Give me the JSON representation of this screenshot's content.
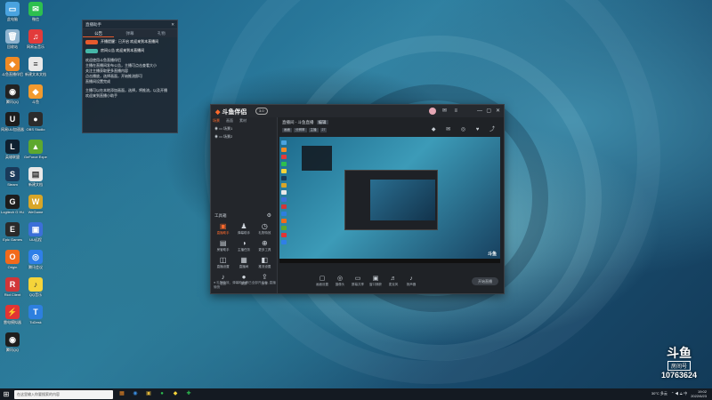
{
  "desktop": {
    "icons": [
      {
        "label": "此电脑",
        "glyph": "▭",
        "color": "#4aa3df"
      },
      {
        "label": "微信",
        "glyph": "✉",
        "color": "#2dbf4f"
      },
      {
        "label": "回收站",
        "glyph": "🗑",
        "color": "#8fb4cf"
      },
      {
        "label": "网易云音乐",
        "glyph": "♫",
        "color": "#e23b3b"
      },
      {
        "label": "斗鱼直播伴侣",
        "glyph": "◆",
        "color": "#f08a24"
      },
      {
        "label": "新建文本文档",
        "glyph": "≡",
        "color": "#e8e8e8"
      },
      {
        "label": "腾讯QQ",
        "glyph": "◉",
        "color": "#222"
      },
      {
        "label": "斗鱼",
        "glyph": "◆",
        "color": "#f29a2e"
      },
      {
        "label": "网易UU加速器",
        "glyph": "U",
        "color": "#1d1d1d"
      },
      {
        "label": "OBS Studio",
        "glyph": "●",
        "color": "#2c2c2c"
      },
      {
        "label": "英雄联盟",
        "glyph": "L",
        "color": "#0f2030"
      },
      {
        "label": "GeForce Experience",
        "glyph": "▲",
        "color": "#5da82e"
      },
      {
        "label": "Steam",
        "glyph": "S",
        "color": "#1a3a5a"
      },
      {
        "label": "新建文档",
        "glyph": "▤",
        "color": "#e8e8e8"
      },
      {
        "label": "Logitech G HUB",
        "glyph": "G",
        "color": "#1c1c1c"
      },
      {
        "label": "WeGame",
        "glyph": "W",
        "color": "#d8a628"
      },
      {
        "label": "Epic Games",
        "glyph": "E",
        "color": "#2a2a2a"
      },
      {
        "label": "UU远程",
        "glyph": "▣",
        "color": "#3c6fd8"
      },
      {
        "label": "Origin",
        "glyph": "O",
        "color": "#f26a1b"
      },
      {
        "label": "腾讯会议",
        "glyph": "◎",
        "color": "#2f7fe8"
      },
      {
        "label": "Riot Client",
        "glyph": "R",
        "color": "#d13639"
      },
      {
        "label": "QQ音乐",
        "glyph": "♪",
        "color": "#f5d43a"
      },
      {
        "label": "雷电模拟器",
        "glyph": "⚡",
        "color": "#e13434"
      },
      {
        "label": "ToDesk",
        "glyph": "T",
        "color": "#2d7fdf"
      },
      {
        "label": "腾讯QQ",
        "glyph": "◉",
        "color": "#1e1e1e"
      }
    ]
  },
  "notice": {
    "title": "直播助手",
    "tabs": [
      "公告",
      "弹幕",
      "礼物"
    ],
    "rows": [
      {
        "text": "开播提醒：已开启 欢迎来到本直播间",
        "pill": "#e65a2d"
      },
      {
        "text": "房间公告 欢迎来到本直播间",
        "pill": "#45b7a8"
      }
    ],
    "body": [
      "欢迎使用斗鱼直播伴侣",
      "主播在直播间发布公告，主播可点击查看大小",
      "关注主播获取更多直播内容",
      "点击播放，选择画面，开始推流即可",
      "直播间设置完成",
      "",
      "主播可以在本地添加画面，选择，将推流，以及开播",
      "欢迎来到直播小助手"
    ]
  },
  "app": {
    "logo": "斗鱼伴侣",
    "version": "3.0",
    "controls": {
      "min": "—",
      "max": "▢",
      "close": "✕"
    },
    "left_tabs": [
      "场景",
      "画面",
      "素材"
    ],
    "scenes": [
      "场景1",
      "场景2"
    ],
    "toolbox_title": "工具箱",
    "tools": [
      {
        "label": "直播助手",
        "glyph": "▣",
        "hot": true
      },
      {
        "label": "弹幕助手",
        "glyph": "♟",
        "hot": false
      },
      {
        "label": "礼物特效",
        "glyph": "◷",
        "hot": false
      },
      {
        "label": "房管助手",
        "glyph": "▤",
        "hot": false
      },
      {
        "label": "主播任务",
        "glyph": "◑",
        "hot": false
      },
      {
        "label": "更多工具",
        "glyph": "⊕",
        "hot": false
      },
      {
        "label": "直播设置",
        "glyph": "◫",
        "hot": false
      },
      {
        "label": "直播间",
        "glyph": "▦",
        "hot": false
      },
      {
        "label": "推流设置",
        "glyph": "◧",
        "hot": false
      },
      {
        "label": "语音",
        "glyph": "♪",
        "hot": false
      },
      {
        "label": "录屏",
        "glyph": "●",
        "hot": false
      },
      {
        "label": "分享",
        "glyph": "⇪",
        "hot": false
      }
    ],
    "left_footer": "● 礼物特效、弹幕助手等已全部开启中, 直播愉快",
    "room_title": "直播间 - 斗鱼直播",
    "room_tag": "编辑",
    "chips": [
      "画面",
      "分辨率",
      "主播",
      "27"
    ],
    "top_icons": "◆ ✉ ◎ ♥ ⤴",
    "preview_mark": "斗鱼",
    "bottom_controls": [
      {
        "label": "画面设置",
        "glyph": "▢"
      },
      {
        "label": "摄像头",
        "glyph": "◎"
      },
      {
        "label": "屏幕共享",
        "glyph": "▭"
      },
      {
        "label": "窗口捕获",
        "glyph": "▣"
      },
      {
        "label": "麦克风",
        "glyph": "♬"
      },
      {
        "label": "扬声器",
        "glyph": "♪"
      }
    ],
    "go_live": "开始直播"
  },
  "watermark": {
    "brand": "斗鱼",
    "room_label": "房间号",
    "room_no": "10763624"
  },
  "taskbar": {
    "start": "⊞",
    "search_placeholder": "在这里输入你要搜索的内容",
    "apps": [
      {
        "glyph": "▦",
        "color": "#f08a24"
      },
      {
        "glyph": "◉",
        "color": "#3b8ee0"
      },
      {
        "glyph": "▣",
        "color": "#e1b63a"
      },
      {
        "glyph": "●",
        "color": "#2dbf4f"
      },
      {
        "glyph": "◆",
        "color": "#f5d43a"
      },
      {
        "glyph": "✚",
        "color": "#2dbf4f"
      }
    ],
    "weather": "30°C 多云",
    "tray_icons": "⌃ ◀ ⟁ 中",
    "time": "19:02",
    "date": "2022/6/23"
  }
}
